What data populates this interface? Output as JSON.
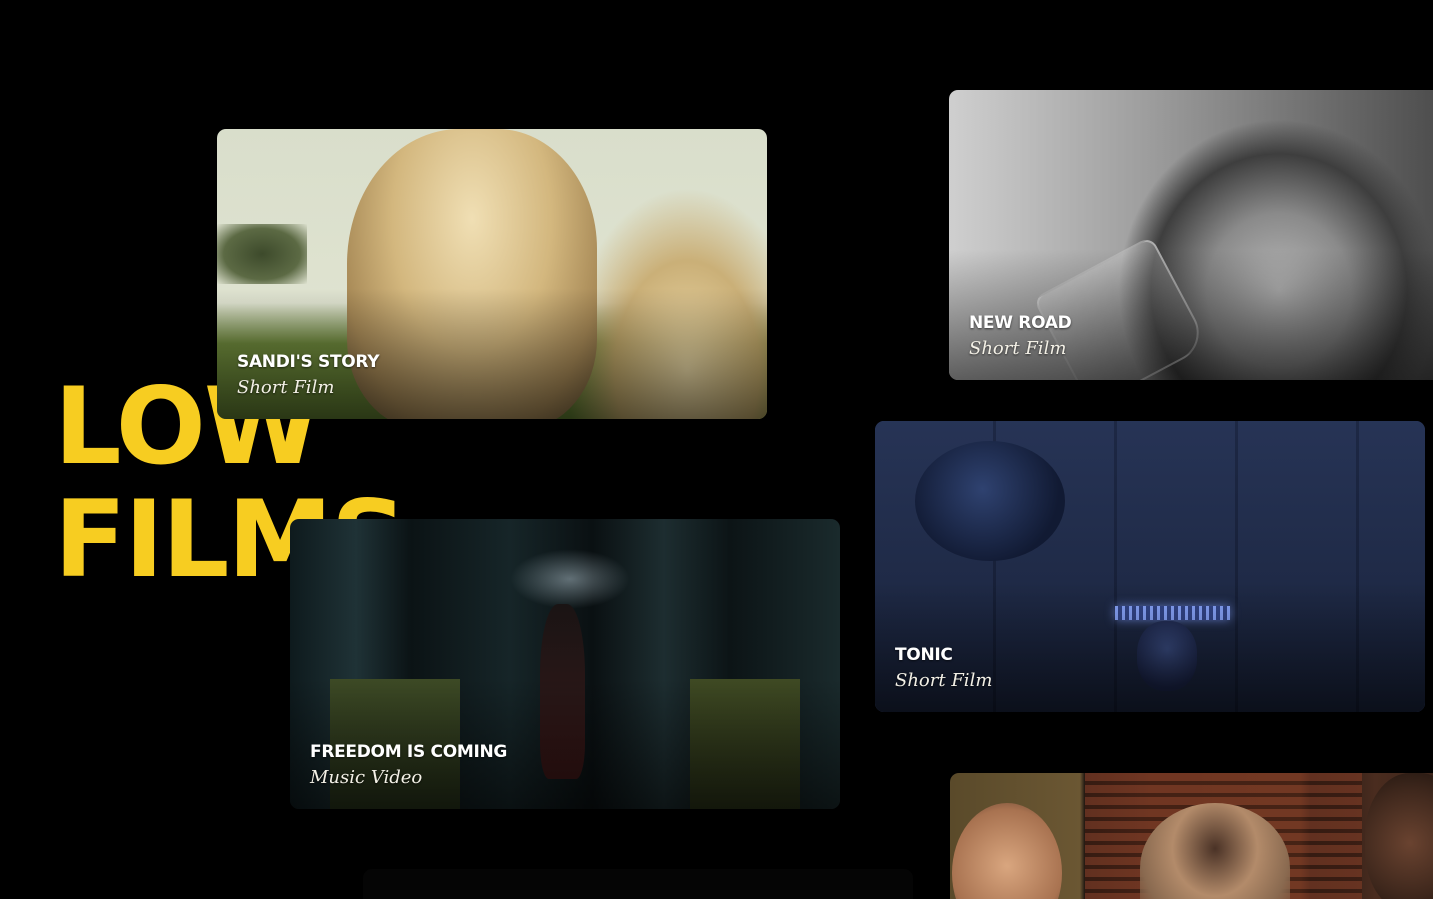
{
  "brand": {
    "line1": "LOW",
    "line2": "FILMS",
    "color": "#f7cd21"
  },
  "cards": {
    "sandi": {
      "title": "SANDI'S STORY",
      "kind": "Short Film"
    },
    "newroad": {
      "title": "NEW ROAD",
      "kind": "Short Film"
    },
    "tonic": {
      "title": "TONIC",
      "kind": "Short Film"
    },
    "freedom": {
      "title": "FREEDOM IS COMING",
      "kind": "Music Video"
    }
  },
  "colors": {
    "background": "#000000",
    "title_text": "#ffffff",
    "kind_text": "#f3f0e6"
  }
}
